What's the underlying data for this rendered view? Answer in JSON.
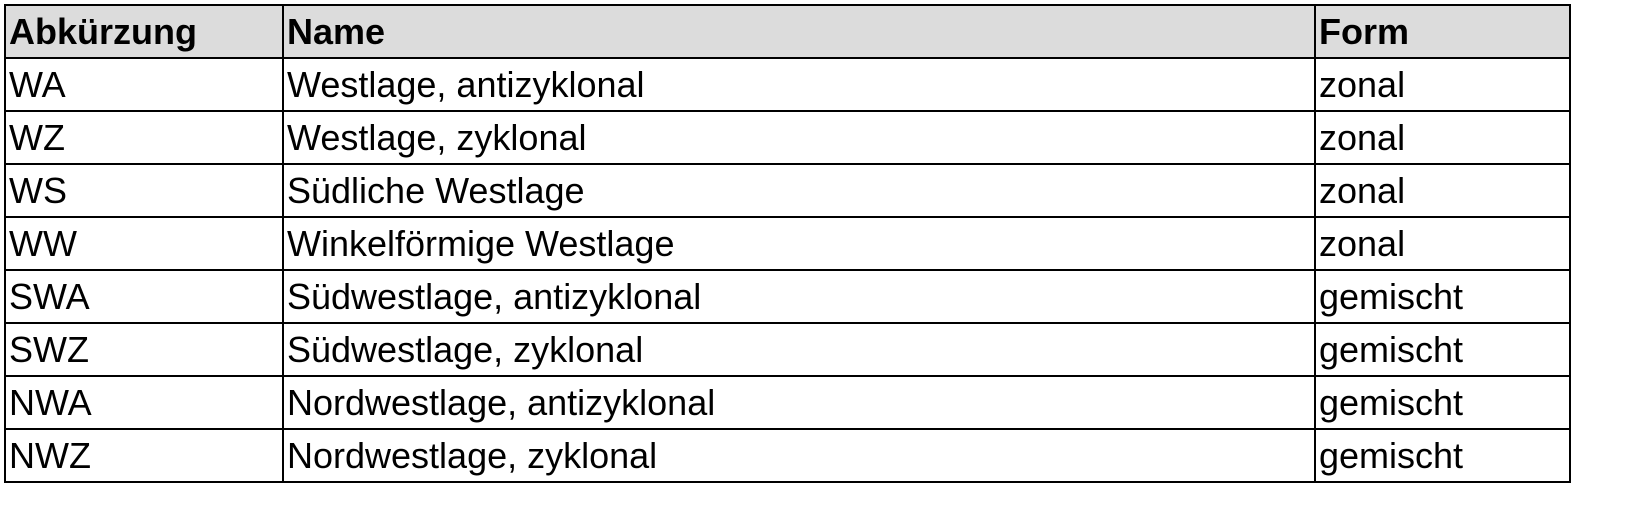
{
  "table": {
    "headers": [
      "Abkürzung",
      "Name",
      "Form"
    ],
    "rows": [
      [
        "WA",
        "Westlage, antizyklonal",
        "zonal"
      ],
      [
        "WZ",
        "Westlage, zyklonal",
        "zonal"
      ],
      [
        "WS",
        "Südliche Westlage",
        "zonal"
      ],
      [
        "WW",
        "Winkelförmige Westlage",
        "zonal"
      ],
      [
        "SWA",
        "Südwestlage, antizyklonal",
        "gemischt"
      ],
      [
        "SWZ",
        "Südwestlage, zyklonal",
        "gemischt"
      ],
      [
        "NWA",
        "Nordwestlage, antizyklonal",
        "gemischt"
      ],
      [
        "NWZ",
        "Nordwestlage, zyklonal",
        "gemischt"
      ]
    ]
  },
  "colors": {
    "header_background": "#dcdcdc",
    "border": "#000000",
    "text": "#000000"
  }
}
